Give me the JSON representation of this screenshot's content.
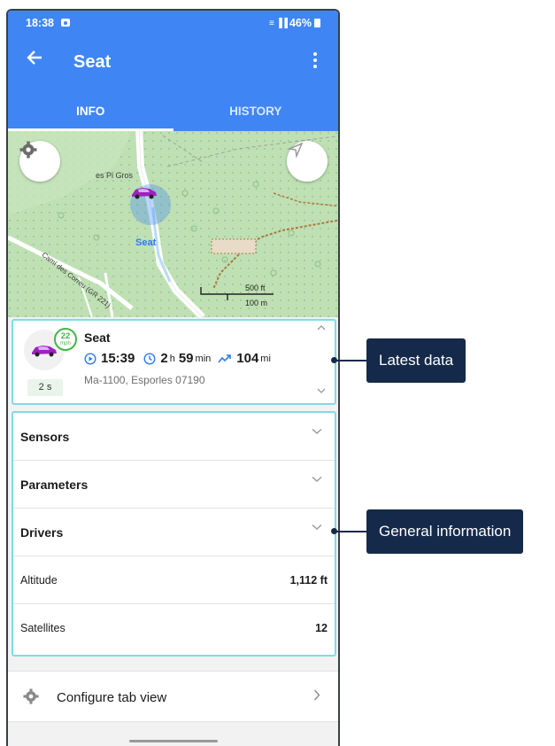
{
  "status_bar": {
    "time": "18:38",
    "battery": "46%"
  },
  "app_bar": {
    "title": "Seat"
  },
  "tabs": [
    {
      "label": "INFO",
      "active": true
    },
    {
      "label": "HISTORY",
      "active": false
    }
  ],
  "map": {
    "place_label": "es Pi Gros",
    "road_label": "Camí des Correu (GR 221)",
    "unit_label": "Seat",
    "scale_ft": "500 ft",
    "scale_m": "100 m"
  },
  "latest_data": {
    "unit_name": "Seat",
    "speed": "22",
    "speed_unit": "mph",
    "last_message_ago": "2 s",
    "time": "15:39",
    "duration_hours": "2",
    "duration_hours_unit": "h",
    "duration_minutes": "59",
    "duration_minutes_unit": "min",
    "mileage": "104",
    "mileage_unit": "mi",
    "address": "Ma-1100, Esporles 07190"
  },
  "general_info": {
    "sensors_label": "Sensors",
    "parameters_label": "Parameters",
    "drivers_label": "Drivers",
    "altitude_label": "Altitude",
    "altitude_value": "1,112 ft",
    "satellites_label": "Satellites",
    "satellites_value": "12"
  },
  "configure": {
    "label": "Configure tab view"
  },
  "callouts": {
    "latest": "Latest data",
    "general": "General information"
  },
  "colors": {
    "primary": "#3f86f4",
    "highlight": "#7fdbe6",
    "callout_bg": "#152a4a",
    "speed_green": "#43b649"
  },
  "icons": [
    "back-arrow-icon",
    "more-vert-icon",
    "gear-icon",
    "navigation-icon",
    "car-icon",
    "play-clock-icon",
    "clock-icon",
    "trend-icon",
    "chevron-down-icon",
    "chevron-up-icon",
    "chevron-right-icon"
  ]
}
